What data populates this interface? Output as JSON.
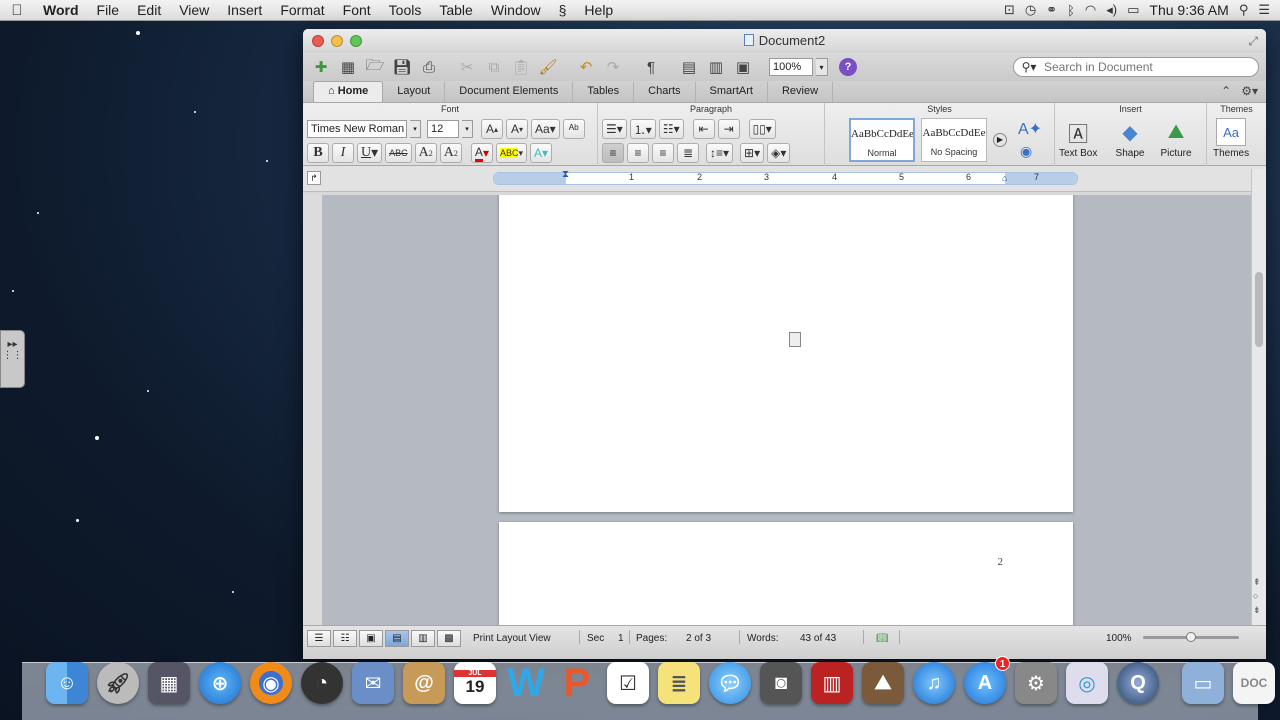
{
  "menubar": {
    "app": "Word",
    "items": [
      "File",
      "Edit",
      "View",
      "Insert",
      "Format",
      "Font",
      "Tools",
      "Table",
      "Window",
      "Help"
    ],
    "clock": "Thu 9:36 AM"
  },
  "window": {
    "title": "Document2",
    "zoom": "100%",
    "search_placeholder": "Search in Document",
    "tabs": [
      "Home",
      "Layout",
      "Document Elements",
      "Tables",
      "Charts",
      "SmartArt",
      "Review"
    ],
    "active_tab": "Home"
  },
  "ribbon": {
    "groups": {
      "font": "Font",
      "paragraph": "Paragraph",
      "styles": "Styles",
      "insert": "Insert",
      "themes": "Themes"
    },
    "font_name": "Times New Roman",
    "font_size": "12",
    "styles": [
      {
        "sample": "AaBbCcDdEe",
        "name": "Normal"
      },
      {
        "sample": "AaBbCcDdEe",
        "name": "No Spacing"
      }
    ],
    "insert_items": [
      "Text Box",
      "Shape",
      "Picture"
    ],
    "themes_label": "Themes"
  },
  "ruler": {
    "numbers": [
      "1",
      "2",
      "3",
      "4",
      "5",
      "6",
      "7"
    ]
  },
  "document": {
    "page2_number": "2"
  },
  "status": {
    "view": "Print Layout View",
    "sec_label": "Sec",
    "sec_value": "1",
    "pages_label": "Pages:",
    "pages_value": "2 of 3",
    "words_label": "Words:",
    "words_value": "43 of 43",
    "zoom": "100%",
    "zoom_level": 0.5
  },
  "dock": {
    "calendar_day": "19",
    "calendar_month": "JUL",
    "appstore_badge": "1"
  },
  "colors": {
    "word_blue": "#2b5797",
    "active_view": "#7ea6da",
    "desktop": "#1a2f4a"
  }
}
